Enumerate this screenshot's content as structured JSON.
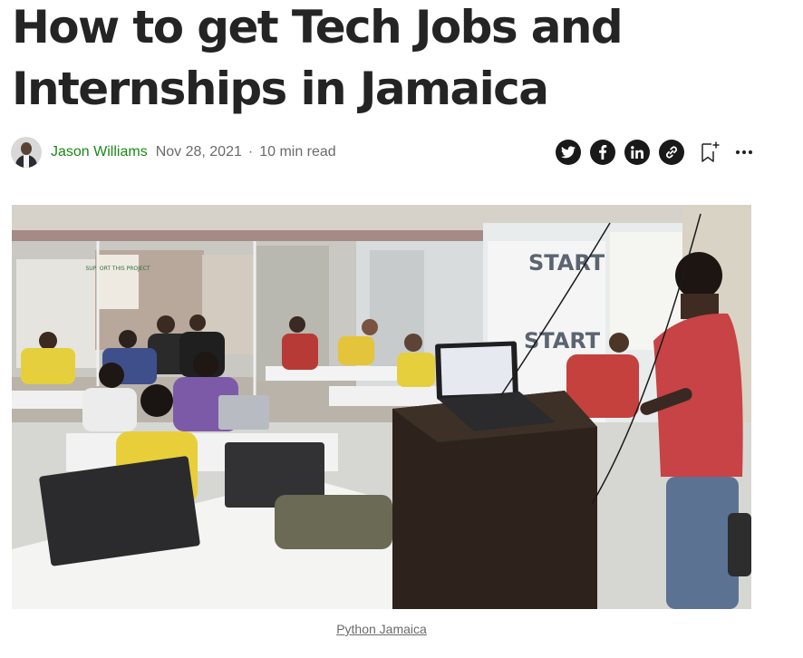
{
  "article": {
    "title": "How to get Tech Jobs and Internships in Jamaica",
    "author": "Jason Williams",
    "date": "Nov 28, 2021",
    "separator": "·",
    "read_time": "10 min read"
  },
  "share": {
    "icons": [
      "twitter-icon",
      "facebook-icon",
      "linkedin-icon",
      "link-icon",
      "bookmark-add-icon",
      "more-icon"
    ],
    "icon_color": "#191919"
  },
  "image": {
    "caption": "Python Jamaica",
    "wall_sign": "SUPPORT THIS PROJECT",
    "banner_text": "START",
    "banner_text_2": "START"
  },
  "colors": {
    "author": "#1a8917",
    "title": "#242424",
    "meta": "#6b6b6b"
  }
}
